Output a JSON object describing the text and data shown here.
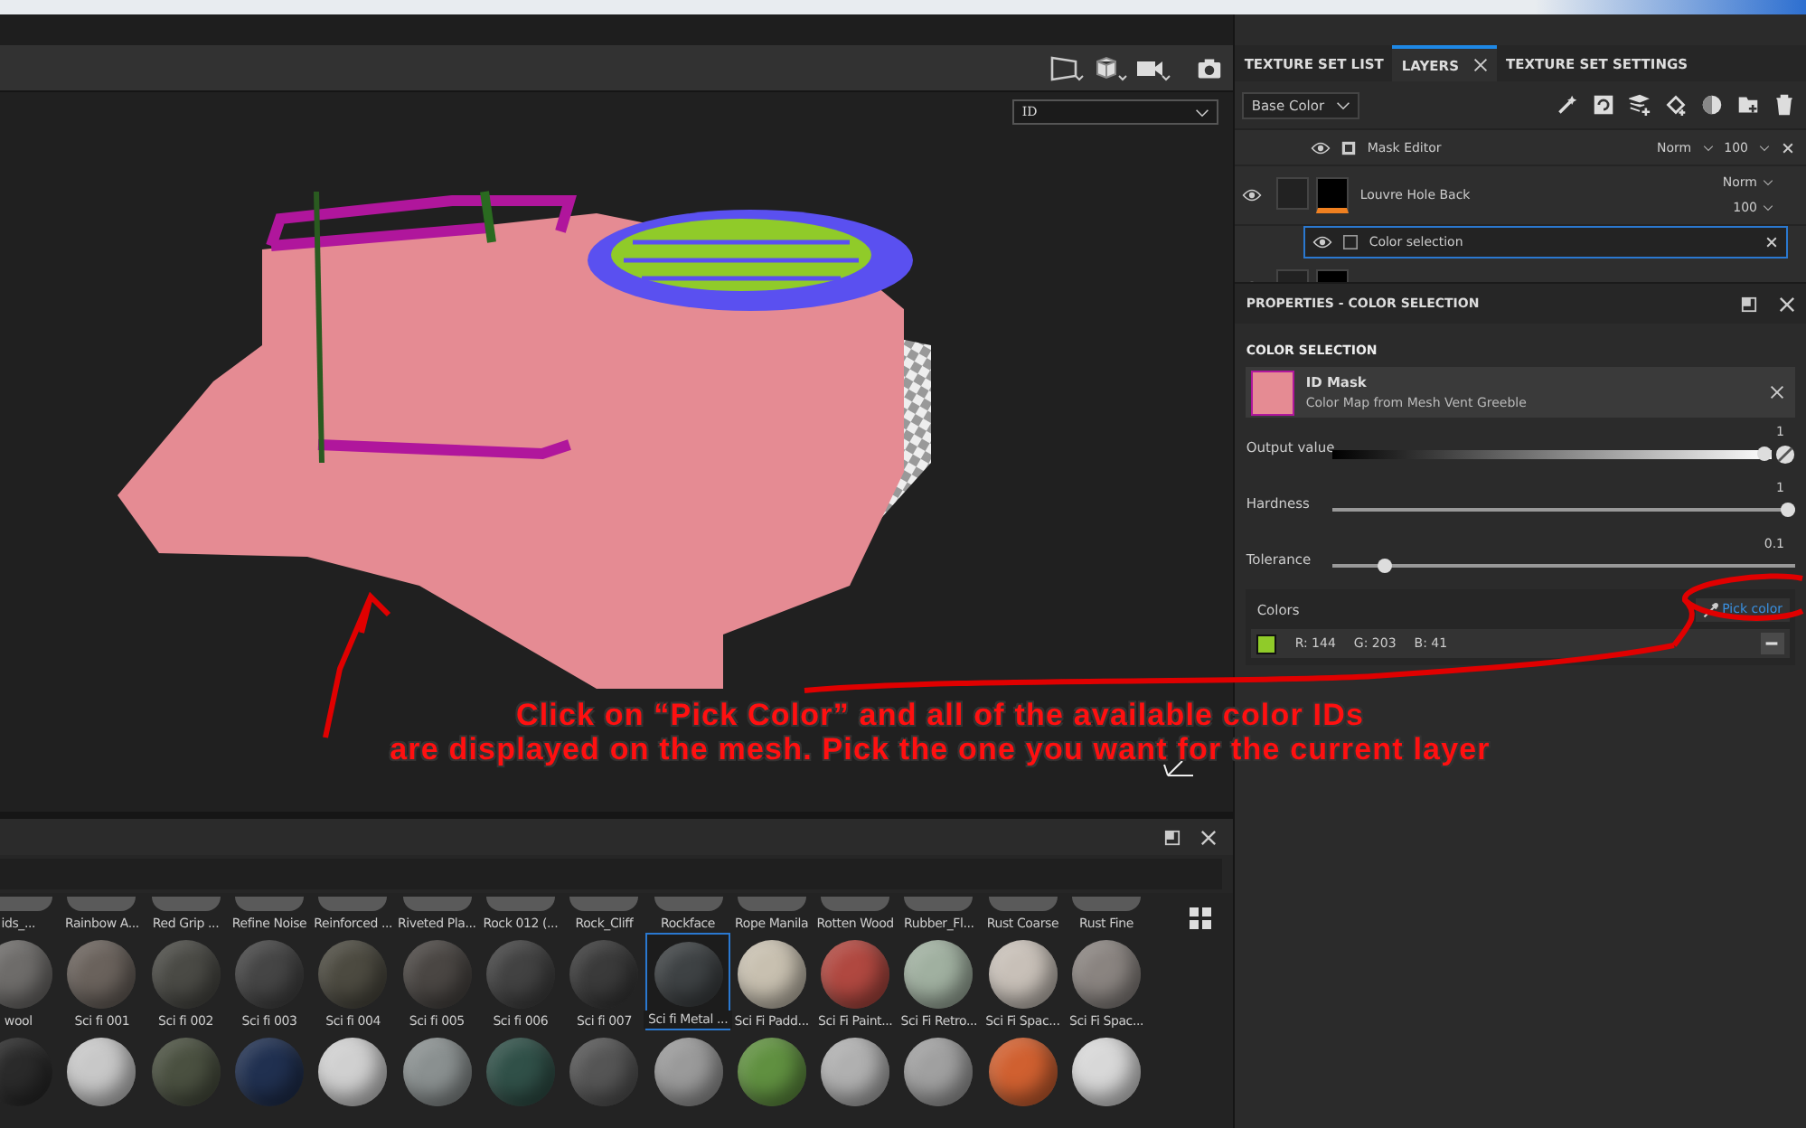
{
  "viewport": {
    "channel_dropdown": "ID"
  },
  "annotation": {
    "lines": [
      "Click on “Pick Color” and all of the available color IDs",
      "are displayed on the mesh.  Pick the one you want for the current layer"
    ]
  },
  "layers_panel": {
    "tabs": [
      {
        "label": "TEXTURE SET LIST",
        "selected": false,
        "closable": false
      },
      {
        "label": "LAYERS",
        "selected": true,
        "closable": true
      },
      {
        "label": "TEXTURE SET SETTINGS",
        "selected": false,
        "closable": false
      }
    ],
    "channel": "Base Color",
    "layers": [
      {
        "kind": "mask",
        "name": "Mask Editor",
        "blend": "Norm",
        "opacity": "100",
        "selected": false
      },
      {
        "kind": "layer",
        "name": "Louvre Hole Back",
        "blend": "Norm",
        "opacity": "100",
        "selected": false
      },
      {
        "kind": "effect",
        "name": "Color selection",
        "selected": true
      },
      {
        "kind": "layer",
        "selected": false
      }
    ]
  },
  "properties": {
    "title": "PROPERTIES - COLOR SELECTION",
    "section": "COLOR SELECTION",
    "id_mask": {
      "title": "ID Mask",
      "subtitle": "Color Map from Mesh Vent Greeble"
    },
    "sliders": [
      {
        "kind": "gradient",
        "label": "Output value",
        "value": "1",
        "level": 1
      },
      {
        "kind": "plain",
        "label": "Hardness",
        "value": "1",
        "level": 1
      },
      {
        "kind": "plain",
        "label": "Tolerance",
        "value": "0.1",
        "level": 0.1
      }
    ],
    "colors": {
      "label": "Colors",
      "pick_button": "Pick color",
      "entries": [
        {
          "color": "#90cb29",
          "r": "R: 144",
          "g": "G: 203",
          "b": "B: 41"
        }
      ]
    }
  },
  "shelf": {
    "row1": [
      "ids_...",
      "Rainbow A...",
      "Red Grip ...",
      "Refine Noise",
      "Reinforced ...",
      "Riveted Pla...",
      "Rock 012 (...",
      "Rock_Cliff",
      "Rockface",
      "Rope Manila",
      "Rotten Wood",
      "Rubber_Fl...",
      "Rust Coarse",
      "Rust Fine"
    ],
    "row2": [
      {
        "label": "wool",
        "color": "#6e6c6a",
        "selected": false
      },
      {
        "label": "Sci fi 001",
        "color": "#6a625c",
        "selected": false
      },
      {
        "label": "Sci fi 002",
        "color": "#4a4a45",
        "selected": false
      },
      {
        "label": "Sci fi 003",
        "color": "#454545",
        "selected": false
      },
      {
        "label": "Sci fi 004",
        "color": "#4c4a40",
        "selected": false
      },
      {
        "label": "Sci fi 005",
        "color": "#4a4643",
        "selected": false
      },
      {
        "label": "Sci fi 006",
        "color": "#424242",
        "selected": false
      },
      {
        "label": "Sci fi 007",
        "color": "#3a3a3a",
        "selected": false
      },
      {
        "label": "Sci fi Metal ...",
        "color": "#3e4244",
        "selected": true
      },
      {
        "label": "Sci Fi Padd...",
        "color": "#c8c0b0",
        "selected": false
      },
      {
        "label": "Sci Fi Paint...",
        "color": "#b04840",
        "selected": false
      },
      {
        "label": "Sci Fi Retro...",
        "color": "#a0b0a0",
        "selected": false
      },
      {
        "label": "Sci Fi Spac...",
        "color": "#c8c0b8",
        "selected": false
      },
      {
        "label": "Sci Fi Spac...",
        "color": "#8a8480",
        "selected": false
      }
    ],
    "row3": [
      {
        "color": "#2a2a2a"
      },
      {
        "color": "#c8c8c8"
      },
      {
        "color": "#4a5040"
      },
      {
        "color": "#203050"
      },
      {
        "color": "#d0d0d0"
      },
      {
        "color": "#8a9090"
      },
      {
        "color": "#305048"
      },
      {
        "color": "#555555"
      },
      {
        "color": "#9a9a9a"
      },
      {
        "color": "#609040"
      },
      {
        "color": "#b0b0b0"
      },
      {
        "color": "#a0a0a0"
      },
      {
        "color": "#d06030"
      },
      {
        "color": "#d8d8d8"
      }
    ]
  }
}
